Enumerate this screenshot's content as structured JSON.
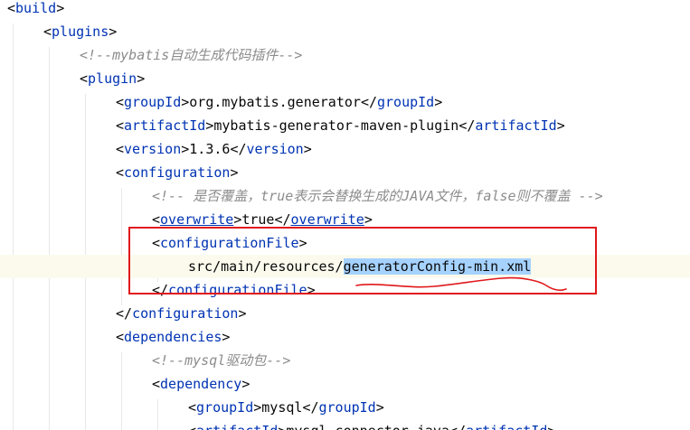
{
  "editor": {
    "lines": [
      {
        "t1": "build"
      },
      {
        "t1": "plugins"
      },
      {
        "comment": "<!--mybatis自动生成代码插件-->"
      },
      {
        "t1": "plugin"
      },
      {
        "t1": "groupId",
        "text": "org.mybatis.generator",
        "t2": "groupId"
      },
      {
        "t1": "artifactId",
        "text": "mybatis-generator-maven-plugin",
        "t2": "artifactId"
      },
      {
        "t1": "version",
        "text": "1.3.6",
        "t2": "version"
      },
      {
        "t1": "configuration"
      },
      {
        "comment": "<!-- 是否覆盖，true表示会替换生成的JAVA文件，false则不覆盖 -->"
      },
      {
        "t1": "overwrite",
        "text": "true",
        "t2": "overwrite"
      },
      {
        "t1": "configurationFile"
      },
      {
        "text_prefix": "src/main/resources/",
        "text_selected": "generatorConfig-min.xml"
      },
      {
        "t2": "configurationFile"
      },
      {
        "t2": "configuration"
      },
      {
        "t1": "dependencies"
      },
      {
        "comment": "<!--mysql驱动包-->"
      },
      {
        "t1": "dependency"
      },
      {
        "t1": "groupId",
        "text": "mysql",
        "t2": "groupId"
      },
      {
        "t1": "artifactId",
        "text": "mysql-connector-java",
        "t2": "artifactId"
      }
    ]
  },
  "annotation": {
    "box_color": "#e0181b"
  }
}
